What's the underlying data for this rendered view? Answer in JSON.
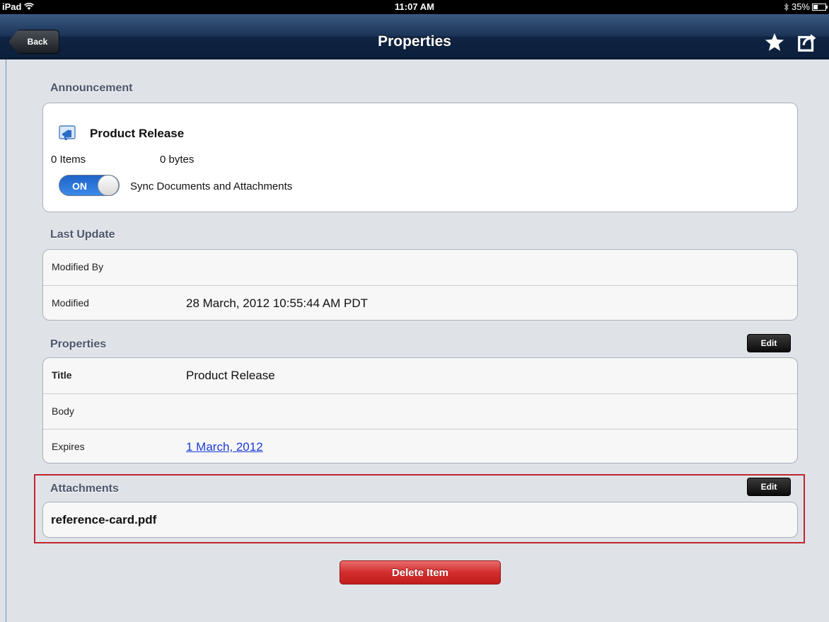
{
  "status_bar": {
    "carrier": "iPad",
    "time": "11:07 AM",
    "battery": "35%",
    "battery_level": 0.35
  },
  "nav": {
    "back_label": "Back",
    "title": "Properties",
    "icons": [
      "star-icon",
      "share-icon"
    ]
  },
  "announcement": {
    "header": "Announcement",
    "title": "Product Release",
    "items": "0 Items",
    "size": "0 bytes",
    "toggle_label": "ON",
    "toggle_state": true,
    "sync_label": "Sync Documents and Attachments"
  },
  "last_update": {
    "header": "Last Update",
    "rows": [
      {
        "label": "Modified By",
        "value": ""
      },
      {
        "label": "Modified",
        "value": "28 March, 2012 10:55:44 AM PDT"
      }
    ]
  },
  "properties": {
    "header": "Properties",
    "edit_label": "Edit",
    "rows": [
      {
        "label": "Title",
        "value": "Product Release"
      },
      {
        "label": "Body",
        "value": ""
      },
      {
        "label": "Expires",
        "value": "1 March, 2012"
      }
    ]
  },
  "attachments": {
    "header": "Attachments",
    "edit_label": "Edit",
    "items": [
      "reference-card.pdf"
    ]
  },
  "actions": {
    "delete_label": "Delete Item"
  },
  "colors": {
    "nav": "#1b3457",
    "delete": "#d22e2e",
    "highlight": "#c0272d",
    "link": "#1a3bd6",
    "toggle": "#2a74dc"
  }
}
